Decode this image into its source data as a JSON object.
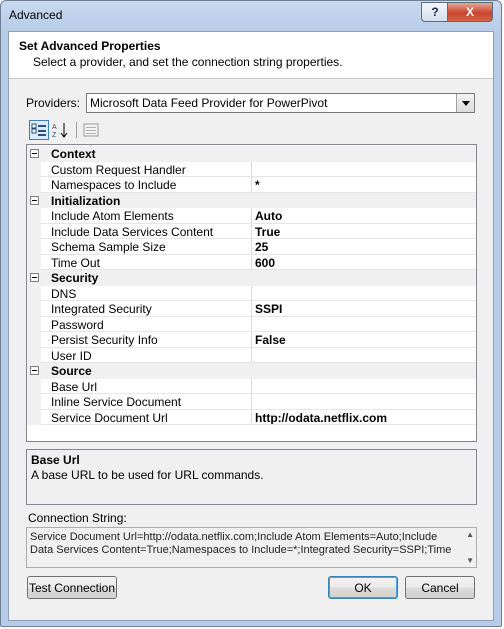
{
  "window": {
    "title": "Advanced"
  },
  "header": {
    "title": "Set Advanced Properties",
    "subtitle": "Select a provider, and set the connection string properties."
  },
  "providers": {
    "label": "Providers:",
    "selected": "Microsoft Data Feed Provider for PowerPivot"
  },
  "grid": {
    "rows": [
      {
        "type": "category",
        "name": "Context"
      },
      {
        "type": "prop",
        "name": "Custom Request Handler",
        "value": ""
      },
      {
        "type": "prop",
        "name": "Namespaces to Include",
        "value": "*"
      },
      {
        "type": "category",
        "name": "Initialization"
      },
      {
        "type": "prop",
        "name": "Include Atom Elements",
        "value": "Auto"
      },
      {
        "type": "prop",
        "name": "Include Data Services Content",
        "value": "True"
      },
      {
        "type": "prop",
        "name": "Schema Sample Size",
        "value": "25"
      },
      {
        "type": "prop",
        "name": "Time Out",
        "value": "600"
      },
      {
        "type": "category",
        "name": "Security"
      },
      {
        "type": "prop",
        "name": "DNS",
        "value": ""
      },
      {
        "type": "prop",
        "name": "Integrated Security",
        "value": "SSPI"
      },
      {
        "type": "prop",
        "name": "Password",
        "value": ""
      },
      {
        "type": "prop",
        "name": "Persist Security Info",
        "value": "False"
      },
      {
        "type": "prop",
        "name": "User ID",
        "value": ""
      },
      {
        "type": "category",
        "name": "Source"
      },
      {
        "type": "prop",
        "name": "Base Url",
        "value": ""
      },
      {
        "type": "prop",
        "name": "Inline Service Document",
        "value": ""
      },
      {
        "type": "prop",
        "name": "Service Document Url",
        "value": "http://odata.netflix.com"
      }
    ]
  },
  "description": {
    "title": "Base Url",
    "text": "A base URL to be used for URL commands."
  },
  "connection": {
    "label": "Connection String:",
    "value": "Service Document Url=http://odata.netflix.com;Include Atom Elements=Auto;Include Data Services Content=True;Namespaces to Include=*;Integrated Security=SSPI;Time"
  },
  "buttons": {
    "test": "Test Connection",
    "ok": "OK",
    "cancel": "Cancel"
  },
  "title_buttons": {
    "help": "?",
    "close": "X"
  }
}
